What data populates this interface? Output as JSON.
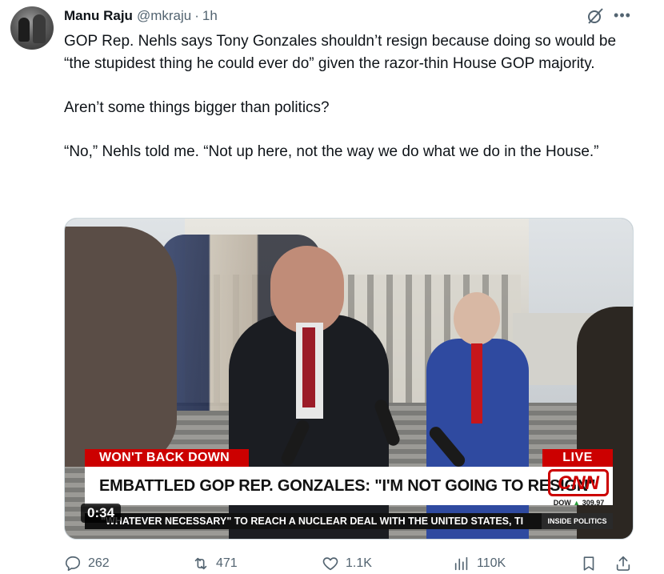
{
  "tweet": {
    "author_name": "Manu Raju",
    "handle": "@mkraju",
    "separator": "·",
    "time": "1h",
    "paragraphs": [
      "GOP Rep. Nehls says Tony Gonzales shouldn’t resign because doing so would be “the stupidest thing he could ever do” given the razor-thin House GOP majority.",
      "Aren’t some things bigger than politics?",
      "“No,” Nehls told me. “Not up here, not the way we do what we do in the House.”"
    ]
  },
  "video": {
    "duration": "0:34",
    "banner_top": "WON'T BACK DOWN",
    "banner_live": "LIVE",
    "headline": "EMBATTLED GOP REP. GONZALES: \"I'M NOT GOING TO RESIGN\"",
    "network_logo": "CNN",
    "dow_label": "DOW",
    "dow_value": "309.97",
    "ticker": "\"WHATEVER NECESSARY\" TO REACH A NUCLEAR DEAL WITH THE UNITED STATES, TI",
    "ticker_tag": "INSIDE POLITICS"
  },
  "actions": {
    "reply_count": "262",
    "repost_count": "471",
    "like_count": "1.1K",
    "view_count": "110K"
  },
  "icons": {
    "grok": "grok-icon",
    "more": "more-icon",
    "reply": "reply-icon",
    "repost": "repost-icon",
    "like": "heart-icon",
    "views": "views-icon",
    "bookmark": "bookmark-icon",
    "share": "share-icon"
  },
  "colors": {
    "text": "#0f1419",
    "secondary": "#536471",
    "cnn_red": "#cc0000"
  }
}
